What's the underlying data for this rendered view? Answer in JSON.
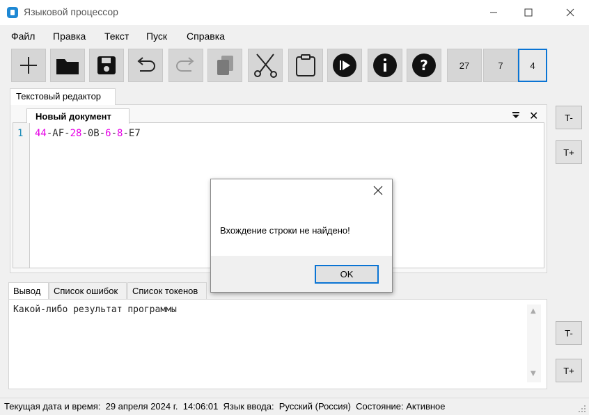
{
  "window": {
    "title": "Языковой процессор",
    "app_icon": "document-app-icon",
    "buttons": [
      "minimize-icon",
      "maximize-icon",
      "close-icon"
    ]
  },
  "menu": {
    "items": [
      "Файл",
      "Правка",
      "Текст",
      "Пуск",
      "Справка"
    ]
  },
  "toolbar": {
    "buttons": [
      {
        "icon": "new-file-icon"
      },
      {
        "icon": "open-folder-icon"
      },
      {
        "icon": "save-icon"
      },
      {
        "icon": "undo-icon"
      },
      {
        "icon": "redo-icon"
      },
      {
        "icon": "copy-icon"
      },
      {
        "icon": "cut-icon"
      },
      {
        "icon": "paste-icon"
      },
      {
        "icon": "run-icon"
      },
      {
        "icon": "info-icon"
      },
      {
        "icon": "help-icon"
      }
    ],
    "numbers": [
      "27",
      "7",
      "4"
    ]
  },
  "editor": {
    "panel_tab": "Текстовый редактор",
    "document_tab": "Новый документ",
    "line_number": "1",
    "code": {
      "t1": "44",
      "t2": "-AF-",
      "t3": "28",
      "t4": "-0B-",
      "t5": "6",
      "t6": "-",
      "t7": "8",
      "t8": "-E7"
    }
  },
  "side_buttons": {
    "top_minus": "T-",
    "top_plus": "T+",
    "bottom_minus": "T-",
    "bottom_plus": "T+"
  },
  "output": {
    "tabs": [
      "Вывод",
      "Список ошибок",
      "Список токенов"
    ],
    "text": "Какой-либо результат программы"
  },
  "status": {
    "text": "Текущая дата и время:  29 апреля 2024 г.  14:06:01  Язык ввода:  Русский (Россия)  Состояние: Активное"
  },
  "dialog": {
    "message": "Вхождение строки не найдено!",
    "ok_label": "OK"
  },
  "colors": {
    "accent": "#0a74d4",
    "highlight": "#e600e6",
    "line_number": "#1b8bb8"
  }
}
